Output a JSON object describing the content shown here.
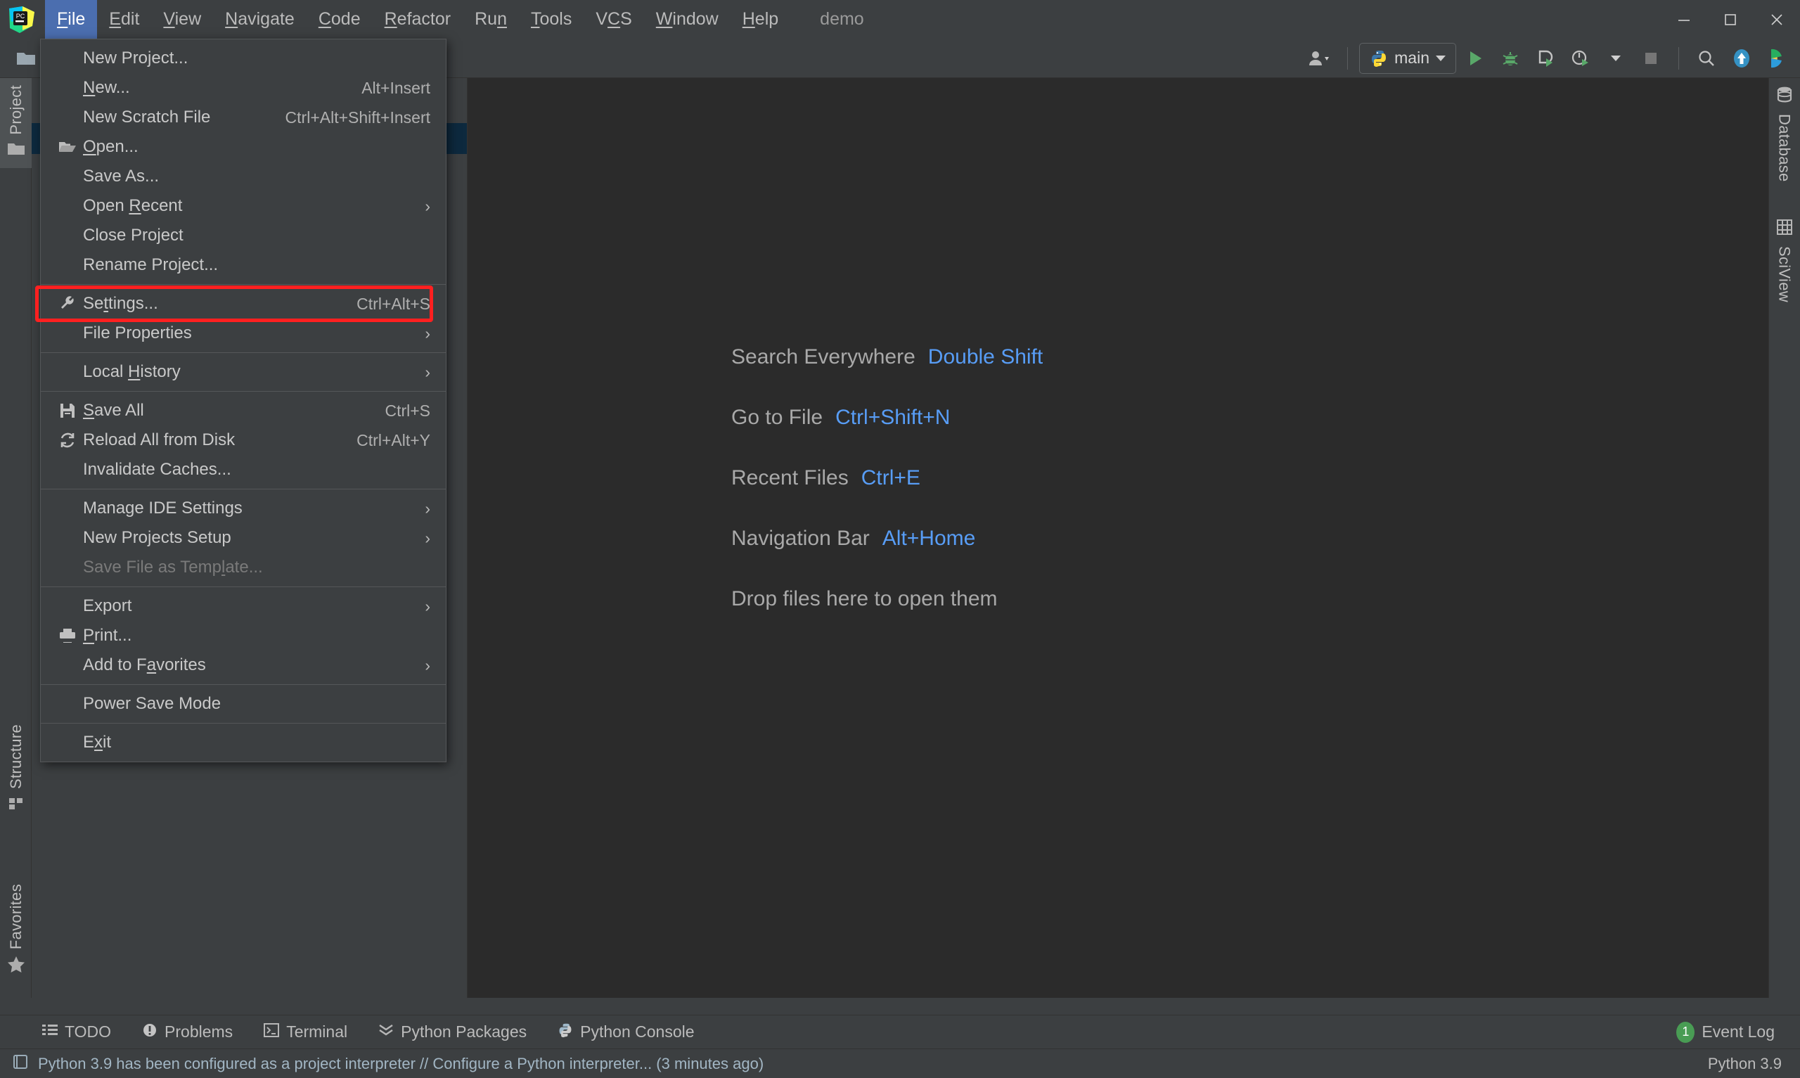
{
  "window": {
    "project_name": "demo",
    "controls": {
      "minimize": "minimize-button",
      "maximize": "maximize-button",
      "close": "close-button"
    }
  },
  "menubar": {
    "items": [
      {
        "label": "File",
        "mnemonic": "F",
        "active": true
      },
      {
        "label": "Edit",
        "mnemonic": "E",
        "active": false
      },
      {
        "label": "View",
        "mnemonic": "V",
        "active": false
      },
      {
        "label": "Navigate",
        "mnemonic": "N",
        "active": false
      },
      {
        "label": "Code",
        "mnemonic": "C",
        "active": false
      },
      {
        "label": "Refactor",
        "mnemonic": "R",
        "active": false
      },
      {
        "label": "Run",
        "mnemonic": "n",
        "active": false
      },
      {
        "label": "Tools",
        "mnemonic": "T",
        "active": false
      },
      {
        "label": "VCS",
        "mnemonic": "",
        "active": false
      },
      {
        "label": "Window",
        "mnemonic": "W",
        "active": false
      },
      {
        "label": "Help",
        "mnemonic": "H",
        "active": false
      }
    ]
  },
  "file_menu": {
    "groups": [
      [
        {
          "label": "New Project...",
          "shortcut": "",
          "icon": "",
          "submenu": false,
          "disabled": false
        },
        {
          "label": "New...",
          "shortcut": "Alt+Insert",
          "icon": "",
          "submenu": false,
          "disabled": false,
          "mnemonic": "N"
        },
        {
          "label": "New Scratch File",
          "shortcut": "Ctrl+Alt+Shift+Insert",
          "icon": "",
          "submenu": false,
          "disabled": false
        },
        {
          "label": "Open...",
          "shortcut": "",
          "icon": "folder-open-icon",
          "submenu": false,
          "disabled": false,
          "mnemonic": "O"
        },
        {
          "label": "Save As...",
          "shortcut": "",
          "icon": "",
          "submenu": false,
          "disabled": false
        },
        {
          "label": "Open Recent",
          "shortcut": "",
          "icon": "",
          "submenu": true,
          "disabled": false,
          "mnemonic": "R"
        },
        {
          "label": "Close Project",
          "shortcut": "",
          "icon": "",
          "submenu": false,
          "disabled": false
        },
        {
          "label": "Rename Project...",
          "shortcut": "",
          "icon": "",
          "submenu": false,
          "disabled": false
        }
      ],
      [
        {
          "label": "Settings...",
          "shortcut": "Ctrl+Alt+S",
          "icon": "wrench-icon",
          "submenu": false,
          "disabled": false,
          "highlighted": true,
          "mnemonic": "t"
        },
        {
          "label": "File Properties",
          "shortcut": "",
          "icon": "",
          "submenu": true,
          "disabled": false
        }
      ],
      [
        {
          "label": "Local History",
          "shortcut": "",
          "icon": "",
          "submenu": true,
          "disabled": false,
          "mnemonic": "H"
        }
      ],
      [
        {
          "label": "Save All",
          "shortcut": "Ctrl+S",
          "icon": "save-icon",
          "submenu": false,
          "disabled": false,
          "mnemonic": "S"
        },
        {
          "label": "Reload All from Disk",
          "shortcut": "Ctrl+Alt+Y",
          "icon": "reload-icon",
          "submenu": false,
          "disabled": false
        },
        {
          "label": "Invalidate Caches...",
          "shortcut": "",
          "icon": "",
          "submenu": false,
          "disabled": false
        }
      ],
      [
        {
          "label": "Manage IDE Settings",
          "shortcut": "",
          "icon": "",
          "submenu": true,
          "disabled": false
        },
        {
          "label": "New Projects Setup",
          "shortcut": "",
          "icon": "",
          "submenu": true,
          "disabled": false
        },
        {
          "label": "Save File as Template...",
          "shortcut": "",
          "icon": "",
          "submenu": false,
          "disabled": true,
          "mnemonic": "l"
        }
      ],
      [
        {
          "label": "Export",
          "shortcut": "",
          "icon": "",
          "submenu": true,
          "disabled": false
        },
        {
          "label": "Print...",
          "shortcut": "",
          "icon": "print-icon",
          "submenu": false,
          "disabled": false,
          "mnemonic": "P"
        },
        {
          "label": "Add to Favorites",
          "shortcut": "",
          "icon": "",
          "submenu": true,
          "disabled": false,
          "mnemonic": "a"
        }
      ],
      [
        {
          "label": "Power Save Mode",
          "shortcut": "",
          "icon": "",
          "submenu": false,
          "disabled": false
        }
      ],
      [
        {
          "label": "Exit",
          "shortcut": "",
          "icon": "",
          "submenu": false,
          "disabled": false,
          "mnemonic": "x"
        }
      ]
    ]
  },
  "toolbar": {
    "run_config": "main",
    "buttons": [
      "user-settings-icon",
      "run-icon",
      "debug-icon",
      "coverage-icon",
      "profile-icon",
      "stop-icon",
      "search-icon",
      "update-project-icon",
      "sciview-icon"
    ]
  },
  "left_strip": {
    "tabs": [
      {
        "label": "Project",
        "icon": "folder-icon",
        "selected": true
      },
      {
        "label": "Structure",
        "icon": "structure-icon",
        "selected": false
      },
      {
        "label": "Favorites",
        "icon": "star-icon",
        "selected": false
      }
    ]
  },
  "right_strip": {
    "tabs": [
      {
        "label": "Database",
        "icon": "database-icon"
      },
      {
        "label": "SciView",
        "icon": "grid-icon"
      }
    ]
  },
  "editor": {
    "hints": [
      {
        "text": "Search Everywhere",
        "key": "Double Shift"
      },
      {
        "text": "Go to File",
        "key": "Ctrl+Shift+N"
      },
      {
        "text": "Recent Files",
        "key": "Ctrl+E"
      },
      {
        "text": "Navigation Bar",
        "key": "Alt+Home"
      }
    ],
    "drop_hint": "Drop files here to open them"
  },
  "bottom_bar": {
    "items": [
      {
        "label": "TODO",
        "icon": "todo-icon"
      },
      {
        "label": "Problems",
        "icon": "problems-icon"
      },
      {
        "label": "Terminal",
        "icon": "terminal-icon"
      },
      {
        "label": "Python Packages",
        "icon": "packages-icon"
      },
      {
        "label": "Python Console",
        "icon": "python-console-icon"
      }
    ],
    "event_log": {
      "label": "Event Log",
      "count": "1"
    }
  },
  "status_bar": {
    "message": "Python 3.9 has been configured as a project interpreter // Configure a Python interpreter... (3 minutes ago)",
    "interpreter": "Python 3.9"
  },
  "colors": {
    "accent_blue": "#4b6eaf",
    "link_blue": "#589df6",
    "highlight_red": "#ff2020",
    "panel_bg": "#3c3f41",
    "editor_bg": "#2b2b2b",
    "badge_green": "#499c54"
  }
}
